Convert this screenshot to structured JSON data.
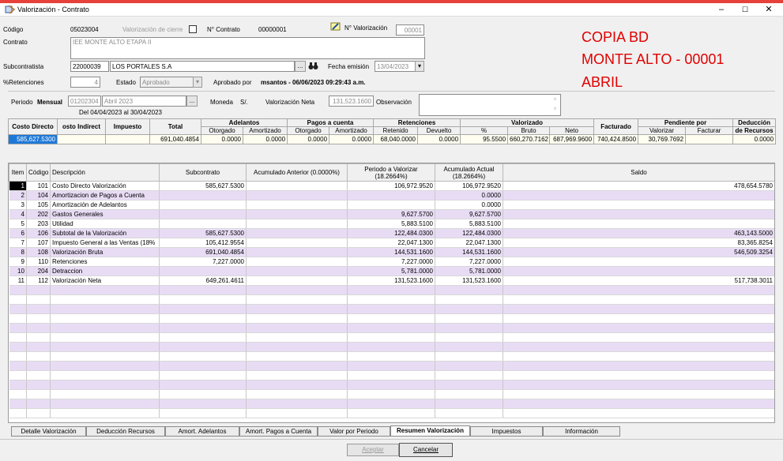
{
  "window": {
    "title": "Valorización - Contrato",
    "minimize": "–",
    "maximize": "☐",
    "close": "✕"
  },
  "header": {
    "codigo_label": "Código",
    "codigo": "05023004",
    "val_cierre_label": "Valorización de cierre",
    "nro_contrato_label": "N° Contrato",
    "nro_contrato": "00000001",
    "nro_val_label": "N° Valorización",
    "nro_val": "00001",
    "contrato_label": "Contrato",
    "contrato": "IEE MONTE ALTO ETAPA II",
    "subcontratista_label": "Subcontratista",
    "sub_code": "22000039",
    "sub_name": "LOS PORTALES S.A",
    "fecha_label": "Fecha emisión",
    "fecha": "13/04/2023",
    "retenciones_label": "%Retenciones",
    "retenciones": "4",
    "estado_label": "Estado",
    "estado": "Aprobado",
    "aprobado_label": "Aprobado por",
    "aprobado": "msantos - 06/06/2023 09:29:43 a.m.",
    "periodo_label": "Periodo",
    "periodo_tipo": "Mensual",
    "periodo_code": "01202304",
    "periodo_name": "Abril 2023",
    "rango": "Del 04/04/2023 al 30/04/2023",
    "moneda_label": "Moneda",
    "moneda": "S/.",
    "val_neta_label": "Valorización Neta",
    "val_neta": "131,523.1600",
    "observacion_label": "Observación",
    "ellipsis": "...",
    "dropdown": "▾"
  },
  "annotation": {
    "line1": "COPIA BD",
    "line2": "MONTE ALTO - 00001",
    "line3": "ABRIL"
  },
  "summary": {
    "h_costo": "Costo Directo",
    "h_costo_ind": "osto Indirect",
    "h_impuesto": "Impuesto",
    "h_total": "Total",
    "h_adelantos": "Adelantos",
    "h_pagos": "Pagos a cuenta",
    "h_retenciones": "Retenciones",
    "h_valorizado": "Valorizado",
    "h_facturado": "Facturado",
    "h_pendiente": "Pendiente por",
    "h_deduccion": "Deducción",
    "s_otorgado": "Otorgado",
    "s_amortizado": "Amortizado",
    "s_otorgado2": "Otorgado",
    "s_amortizado2": "Amortizado",
    "s_retenido": "Retenido",
    "s_devuelto": "Devuelto",
    "s_pct": "%",
    "s_bruto": "Bruto",
    "s_neto": "Neto",
    "s_valorizar": "Valorizar",
    "s_facturar": "Facturar",
    "s_recursos": "de Recursos",
    "row": {
      "costo": "585,627.5300",
      "costo_ind": "",
      "impuesto": "",
      "total": "691,040.4854",
      "adel_otorgado": "0.0000",
      "adel_amortizado": "0.0000",
      "pagos_otorgado": "0.0000",
      "pagos_amortizado": "0.0000",
      "retenido": "68,040.0000",
      "devuelto": "0.0000",
      "pct": "95.5500",
      "bruto": "660,270.7162",
      "neto": "687,969.9600",
      "facturado": "740,424.8500",
      "valorizar": "30,769.7692",
      "facturar": "",
      "recursos": "0.0000"
    }
  },
  "grid": {
    "headers": {
      "item": "Item",
      "codigo": "Código",
      "descripcion": "Descripción",
      "subcontrato": "Subcontrato",
      "acumulado_anterior": "Acumulado Anterior (0.0000%)",
      "periodo": "Periodo a Valorizar (18.2664%)",
      "acumulado_actual": "Acumulado Actual (18.2664%)",
      "saldo": "Saldo"
    },
    "rows": [
      {
        "item": "1",
        "codigo": "101",
        "desc": "Costo Directo Valorización",
        "sub": "585,627.5300",
        "ant": "",
        "per": "106,972.9520",
        "act": "106,972.9520",
        "saldo": "478,654.5780"
      },
      {
        "item": "2",
        "codigo": "104",
        "desc": "Amortizacion de Pagos a Cuenta",
        "sub": "",
        "ant": "",
        "per": "",
        "act": "0.0000",
        "saldo": ""
      },
      {
        "item": "3",
        "codigo": "105",
        "desc": "Amortización de Adelantos",
        "sub": "",
        "ant": "",
        "per": "",
        "act": "0.0000",
        "saldo": ""
      },
      {
        "item": "4",
        "codigo": "202",
        "desc": "Gastos Generales",
        "sub": "",
        "ant": "",
        "per": "9,627.5700",
        "act": "9,627.5700",
        "saldo": ""
      },
      {
        "item": "5",
        "codigo": "203",
        "desc": "Utilidad",
        "sub": "",
        "ant": "",
        "per": "5,883.5100",
        "act": "5,883.5100",
        "saldo": ""
      },
      {
        "item": "6",
        "codigo": "106",
        "desc": "Subtotal de la Valorización",
        "sub": "585,627.5300",
        "ant": "",
        "per": "122,484.0300",
        "act": "122,484.0300",
        "saldo": "463,143.5000"
      },
      {
        "item": "7",
        "codigo": "107",
        "desc": "Impuesto General a las Ventas (18%",
        "sub": "105,412.9554",
        "ant": "",
        "per": "22,047.1300",
        "act": "22,047.1300",
        "saldo": "83,365.8254"
      },
      {
        "item": "8",
        "codigo": "108",
        "desc": "Valorización Bruta",
        "sub": "691,040.4854",
        "ant": "",
        "per": "144,531.1600",
        "act": "144,531.1600",
        "saldo": "546,509.3254"
      },
      {
        "item": "9",
        "codigo": "110",
        "desc": "Retenciones",
        "sub": "7,227.0000",
        "ant": "",
        "per": "7,227.0000",
        "act": "7,227.0000",
        "saldo": ""
      },
      {
        "item": "10",
        "codigo": "204",
        "desc": "Detraccion",
        "sub": "",
        "ant": "",
        "per": "5,781.0000",
        "act": "5,781.0000",
        "saldo": ""
      },
      {
        "item": "11",
        "codigo": "112",
        "desc": "Valorización Neta",
        "sub": "649,261.4611",
        "ant": "",
        "per": "131,523.1600",
        "act": "131,523.1600",
        "saldo": "517,738.3011"
      }
    ]
  },
  "tabs": [
    "Detalle Valorización",
    "Deducción Recursos",
    "Amort. Adelantos",
    "Amort. Pagos a Cuenta",
    "Valor por Periodo",
    "Resumen Valorización",
    "Impuestos",
    "Información"
  ],
  "buttons": {
    "aceptar": "Aceptar",
    "cancelar": "Cancelar"
  }
}
